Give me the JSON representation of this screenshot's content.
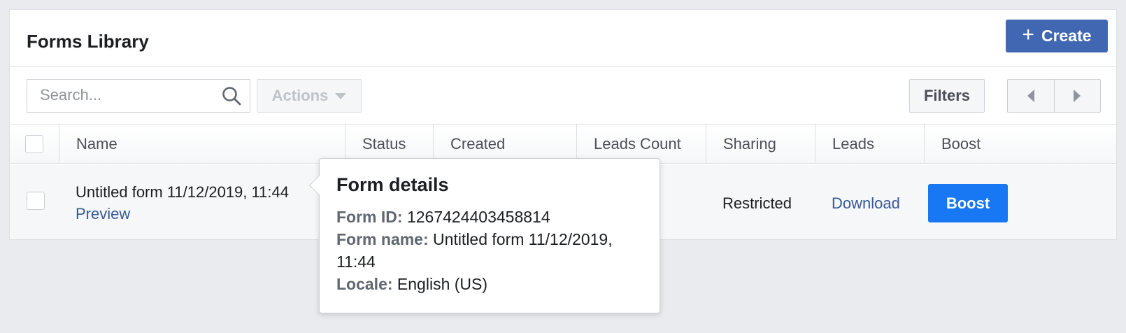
{
  "header": {
    "title": "Forms Library",
    "create_label": "Create"
  },
  "toolbar": {
    "search_placeholder": "Search...",
    "actions_label": "Actions",
    "filters_label": "Filters"
  },
  "table": {
    "columns": [
      "Name",
      "Status",
      "Created",
      "Leads Count",
      "Sharing",
      "Leads",
      "Boost"
    ],
    "rows": [
      {
        "name": "Untitled form 11/12/2019, 11:44",
        "preview_label": "Preview",
        "sharing": "Restricted",
        "leads_label": "Download",
        "boost_label": "Boost"
      }
    ]
  },
  "tooltip": {
    "title": "Form details",
    "form_id_label": "Form ID:",
    "form_id": "1267424403458814",
    "form_name_label": "Form name:",
    "form_name": "Untitled form 11/12/2019, 11:44",
    "locale_label": "Locale:",
    "locale": "English (US)"
  },
  "colors": {
    "brand": "#4267b2",
    "boost": "#1877f2",
    "link": "#385898"
  },
  "icons": [
    "plus-icon",
    "search-icon",
    "caret-down-icon",
    "arrow-left-icon",
    "arrow-right-icon"
  ]
}
